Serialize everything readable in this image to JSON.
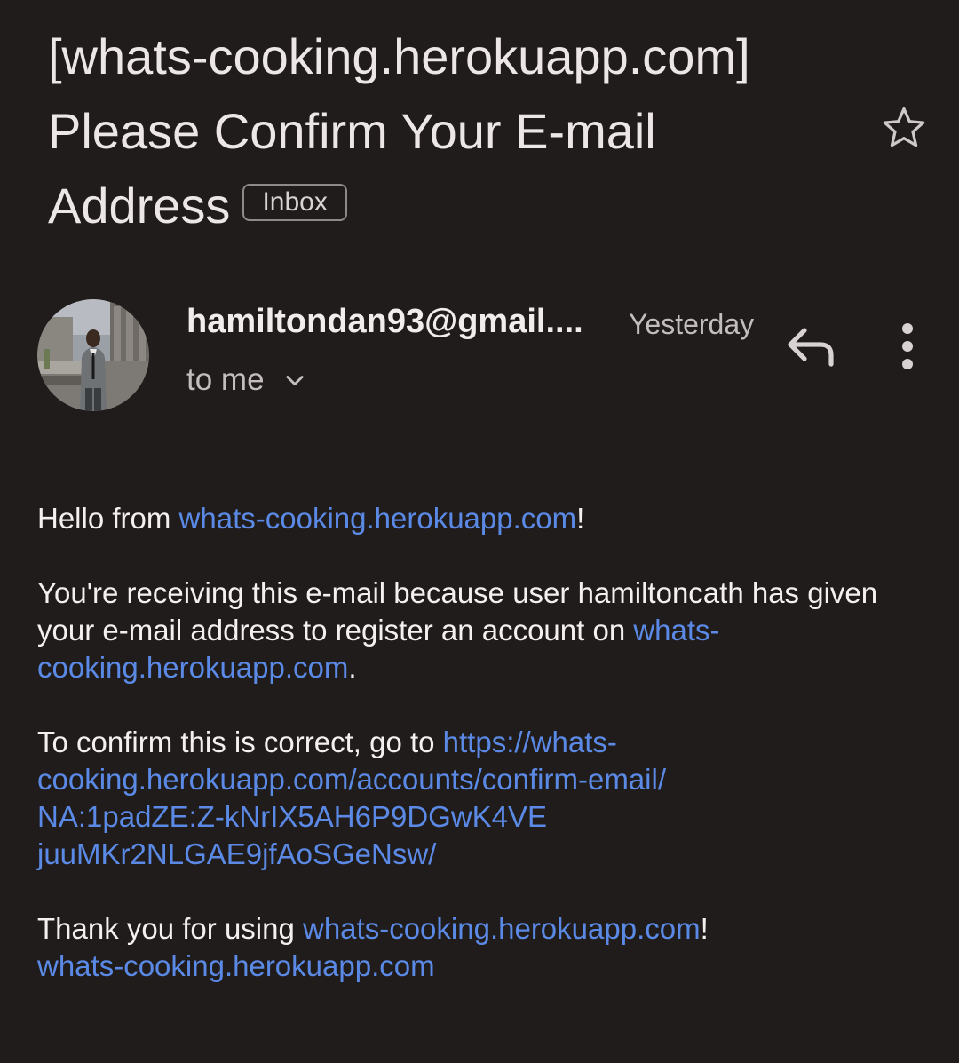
{
  "email": {
    "subject_line_1": "[whats-cooking.herokuapp.com]",
    "subject_line_2": "Please Confirm Your E-mail",
    "subject_line_3": "Address",
    "label": "Inbox",
    "sender": "hamiltondan93@gmail....",
    "date": "Yesterday",
    "recipient": "to me",
    "body": {
      "greeting_text": "Hello from ",
      "greeting_link": "whats-cooking.herokuapp.com",
      "greeting_end": "!",
      "reason_text": "You're receiving this e-mail because user hamiltoncath has given your e-mail address to register an account on ",
      "reason_link": "whats-cooking.herokuapp.com",
      "reason_end": ".",
      "confirm_text": "To confirm this is correct, go to ",
      "confirm_link_1": "https://whats-",
      "confirm_link_2": "cooking.herokuapp.com/accounts/confirm-email/",
      "confirm_link_3": "NA:1padZE:Z-kNrIX5AH6P9DGwK4VE",
      "confirm_link_4": "juuMKr2NLGAE9jfAoSGeNsw/",
      "thanks_text": "Thank you for using ",
      "thanks_link": "whats-cooking.herokuapp.com",
      "thanks_end": "!",
      "signature_link": "whats-cooking.herokuapp.com"
    }
  },
  "icons": {
    "star": "star-outline-icon",
    "reply": "reply-icon",
    "more": "more-vertical-icon",
    "chevron": "chevron-down-icon"
  },
  "colors": {
    "background": "#201c1c",
    "link": "#5b8ae6",
    "text": "#f5f0f0",
    "muted": "#c4bdbd"
  }
}
